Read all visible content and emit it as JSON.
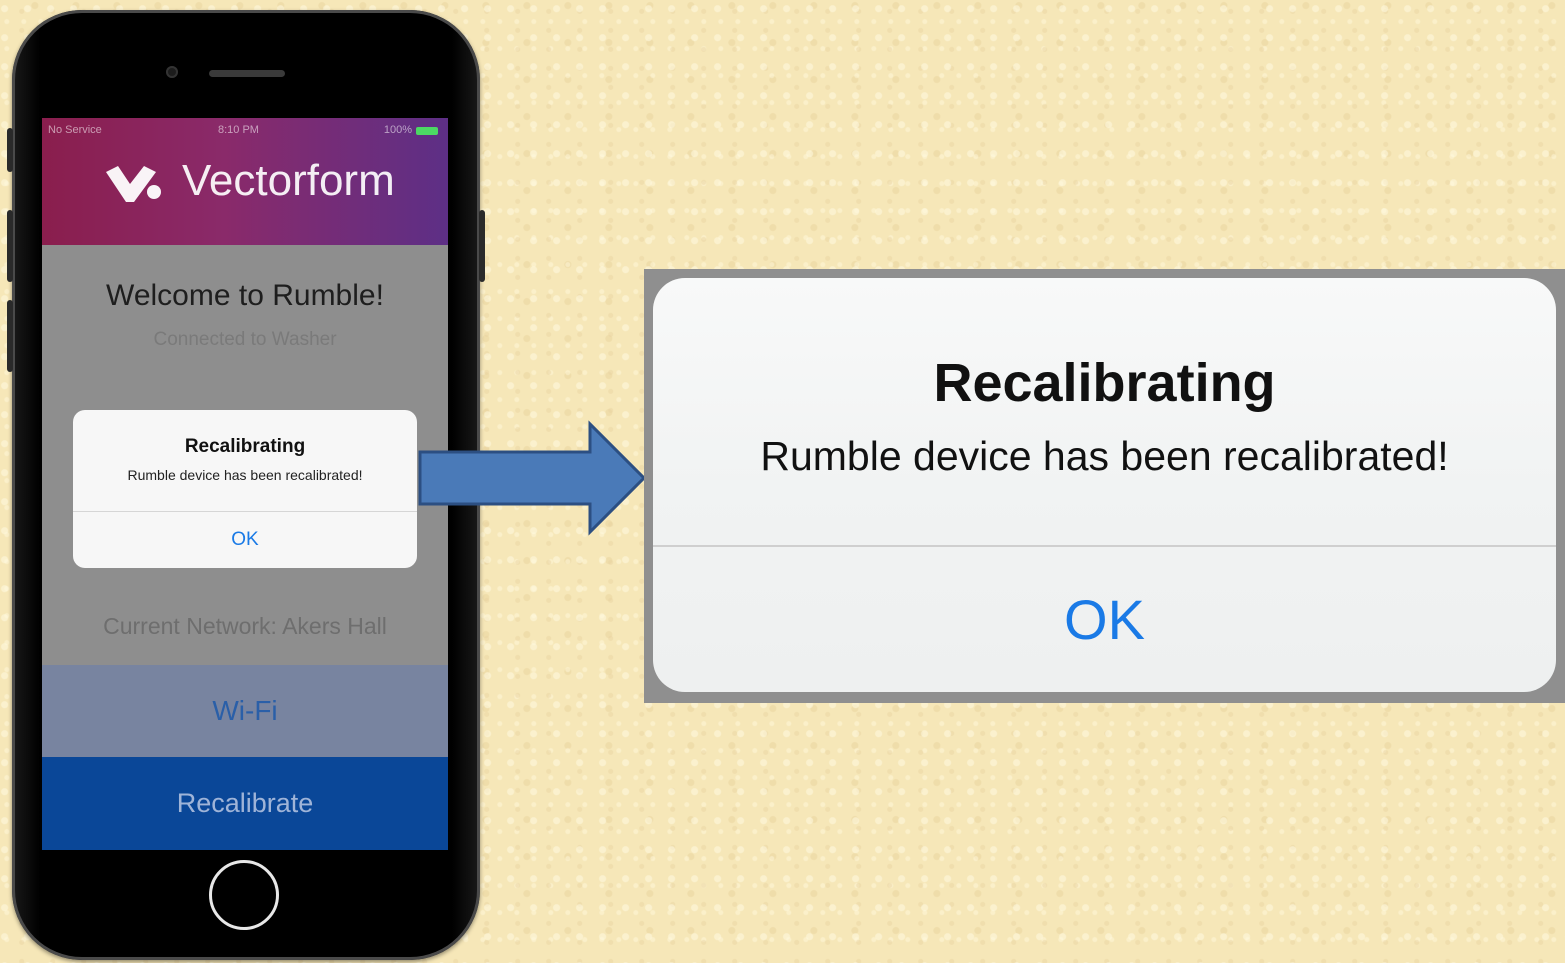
{
  "phone": {
    "status_bar": {
      "carrier": "No Service",
      "time": "8:10 PM",
      "battery": "100%"
    },
    "header": {
      "brand_name": "Vectorform",
      "logo_icon": "vectorform-logo-icon"
    },
    "welcome_title": "Welcome to Rumble!",
    "connected_text": "Connected to Washer",
    "network_text": "Current Network: Akers Hall",
    "wifi_button": "Wi-Fi",
    "recalibrate_button": "Recalibrate",
    "alert": {
      "title": "Recalibrating",
      "message": "Rumble device has been recalibrated!",
      "ok_label": "OK"
    }
  },
  "zoomed_alert": {
    "title": "Recalibrating",
    "message": "Rumble device has been recalibrated!",
    "ok_label": "OK"
  },
  "colors": {
    "background": "#f6e7b8",
    "header_start": "#8a1e4d",
    "header_end": "#5d2f86",
    "wifi_button_bg": "#7884a0",
    "recalibrate_bg": "#0a4798",
    "ios_blue": "#1a7ae6",
    "arrow_fill": "#4a7ab8",
    "arrow_stroke": "#2c4f82"
  }
}
